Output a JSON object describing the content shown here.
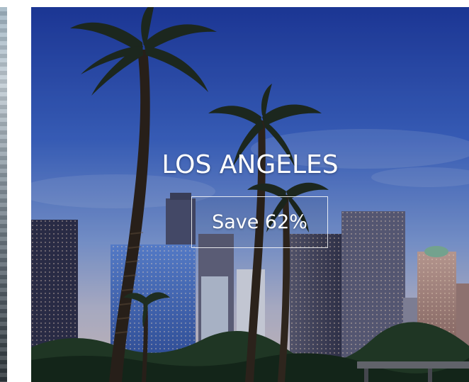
{
  "carousel": {
    "prev_card": {
      "image": "city-buildings-photo"
    },
    "card": {
      "image": "los-angeles-palm-trees-skyline-photo",
      "title": "LOS ANGELES",
      "cta_label": "Save 62%"
    }
  },
  "colors": {
    "title_text": "#ffffff",
    "cta_border": "#ffffff"
  }
}
